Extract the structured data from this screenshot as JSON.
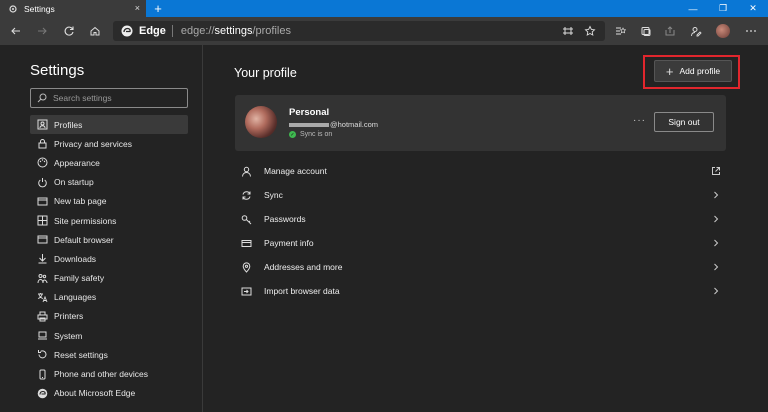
{
  "browser": {
    "tab_title": "Settings",
    "tab_close": "×",
    "new_tab": "+",
    "window_controls": [
      "—",
      "❐",
      "✕"
    ],
    "address": {
      "brand": "Edge",
      "url_prefix": "edge://",
      "url_main": "settings",
      "url_suffix": "/profiles"
    }
  },
  "sidebar": {
    "title": "Settings",
    "search_placeholder": "Search settings",
    "items": [
      {
        "label": "Profiles",
        "icon": "profile-icon",
        "active": true
      },
      {
        "label": "Privacy and services",
        "icon": "lock-icon"
      },
      {
        "label": "Appearance",
        "icon": "palette-icon"
      },
      {
        "label": "On startup",
        "icon": "power-icon"
      },
      {
        "label": "New tab page",
        "icon": "new-tab-icon"
      },
      {
        "label": "Site permissions",
        "icon": "grid-icon"
      },
      {
        "label": "Default browser",
        "icon": "browser-icon"
      },
      {
        "label": "Downloads",
        "icon": "download-icon"
      },
      {
        "label": "Family safety",
        "icon": "family-icon"
      },
      {
        "label": "Languages",
        "icon": "language-icon"
      },
      {
        "label": "Printers",
        "icon": "printer-icon"
      },
      {
        "label": "System",
        "icon": "system-icon"
      },
      {
        "label": "Reset settings",
        "icon": "reset-icon"
      },
      {
        "label": "Phone and other devices",
        "icon": "phone-icon"
      },
      {
        "label": "About Microsoft Edge",
        "icon": "edge-icon"
      }
    ]
  },
  "main": {
    "title": "Your profile",
    "add_profile": "Add profile",
    "profile": {
      "name": "Personal",
      "email_suffix": "@hotmail.com",
      "sync_status": "Sync is on",
      "more": "···",
      "sign_out": "Sign out"
    },
    "rows": [
      {
        "label": "Manage account",
        "icon": "person-icon",
        "trail": "external-link-icon"
      },
      {
        "label": "Sync",
        "icon": "sync-icon",
        "trail": "chevron-right-icon"
      },
      {
        "label": "Passwords",
        "icon": "key-icon",
        "trail": "chevron-right-icon"
      },
      {
        "label": "Payment info",
        "icon": "card-icon",
        "trail": "chevron-right-icon"
      },
      {
        "label": "Addresses and more",
        "icon": "location-icon",
        "trail": "chevron-right-icon"
      },
      {
        "label": "Import browser data",
        "icon": "import-icon",
        "trail": "chevron-right-icon"
      }
    ]
  },
  "colors": {
    "accent_bar": "#0a77d5",
    "highlight": "#e1262d",
    "sync_green": "#3fb950"
  }
}
